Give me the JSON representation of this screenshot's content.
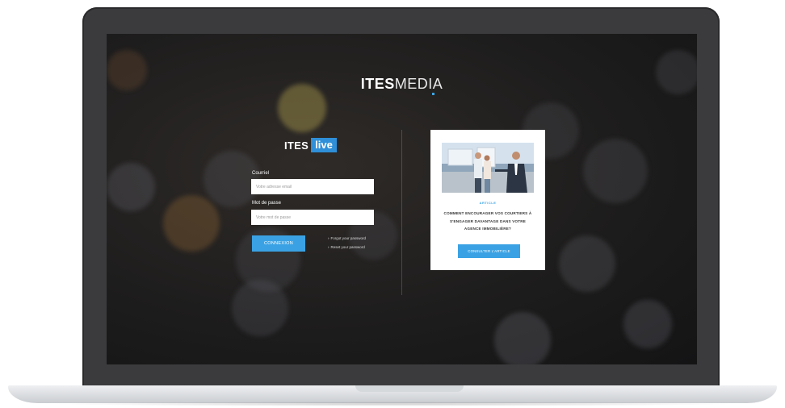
{
  "brand": {
    "bold": "ITES",
    "light": "MEDIA"
  },
  "login": {
    "logo_left": "ITES",
    "logo_right": "live",
    "tagline": "",
    "email_label": "Courriel",
    "email_placeholder": "Votre adresse email",
    "password_label": "Mot de passe",
    "password_placeholder": "Votre mot de passe",
    "submit_label": "CONNEXION",
    "forgot_link": "Forgot your password",
    "reset_link": "Reset your password"
  },
  "article": {
    "label": "ARTICLE",
    "title": "COMMENT ENCOURAGER VOS COURTIERS À S'ENGAGER DAVANTAGE DANS VOTRE AGENCE IMMOBILIÈRE?",
    "button_label": "CONSULTER L'ARTICLE"
  },
  "colors": {
    "accent": "#3aa2e4",
    "screen_bg": "#1e1d1d",
    "bezel": "#3b3b3d"
  },
  "icons": {
    "link_arrow": "chevron-right-icon"
  }
}
